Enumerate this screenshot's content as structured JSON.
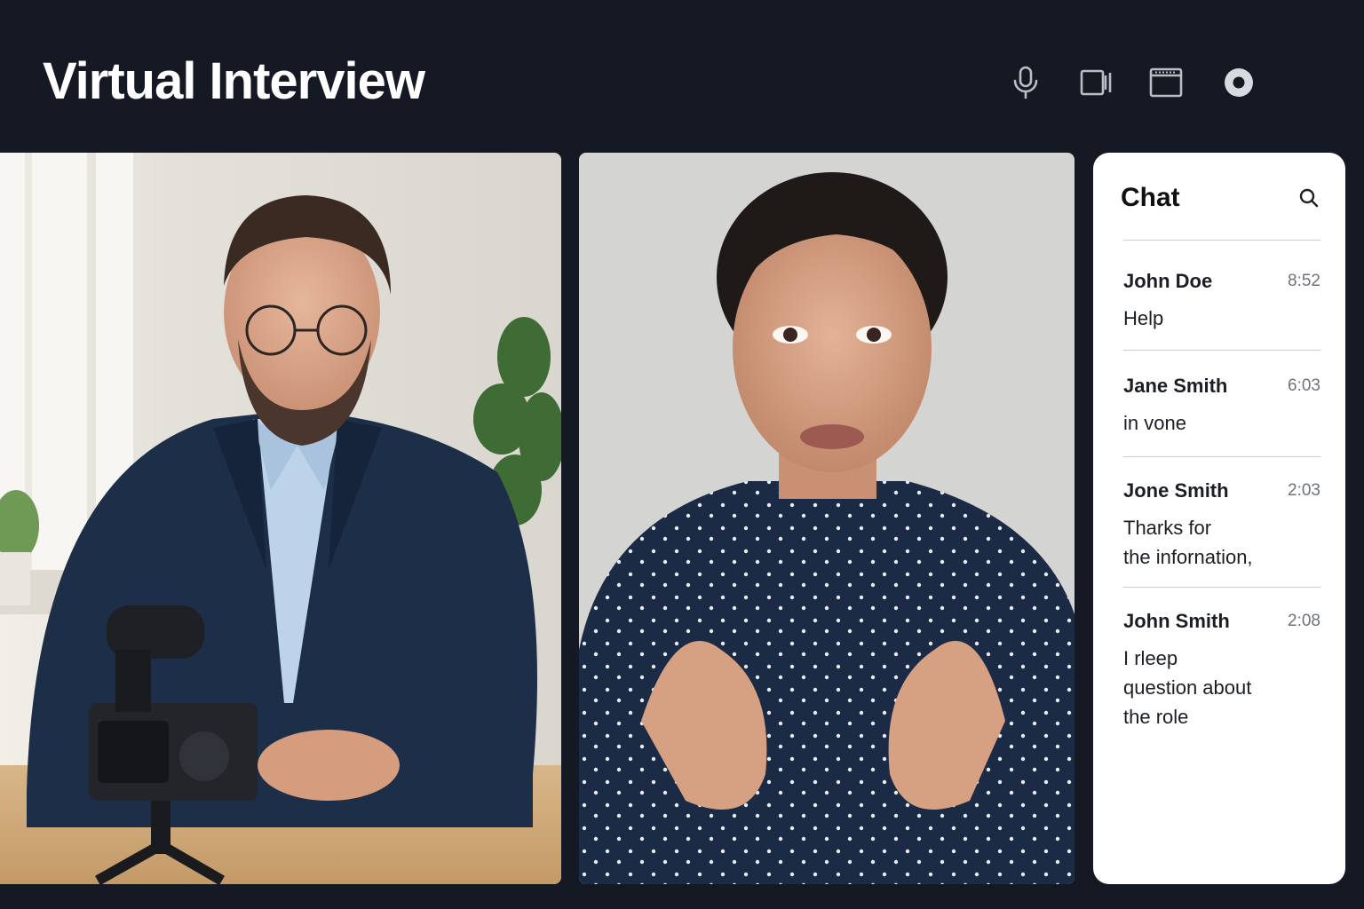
{
  "header": {
    "title": "Virtual Interview"
  },
  "toolbar": {
    "buttons": [
      {
        "name": "microphone",
        "icon": "microphone-icon"
      },
      {
        "name": "camera",
        "icon": "video-camera-icon"
      },
      {
        "name": "screen-share",
        "icon": "screen-window-icon"
      },
      {
        "name": "record",
        "icon": "record-icon"
      }
    ]
  },
  "chat": {
    "title": "Chat",
    "search_icon": "search-icon",
    "messages": [
      {
        "name": "John Doe",
        "time": "8:52",
        "text": "Help"
      },
      {
        "name": "Jane Smith",
        "time": "6:03",
        "text": "in  vone"
      },
      {
        "name": "Jone Smith",
        "time": "2:03",
        "text": "Tharks for\nthe infornation,"
      },
      {
        "name": "John Smith",
        "time": "2:08",
        "text": "I rleep\nquestion about\nthe role"
      }
    ]
  },
  "colors": {
    "background": "#141923",
    "header_text": "#ffffff",
    "icon": "#b9bdc4",
    "chat_bg": "#ffffff",
    "jacket": "#1c2e48",
    "blouse": "#1b2a45"
  }
}
